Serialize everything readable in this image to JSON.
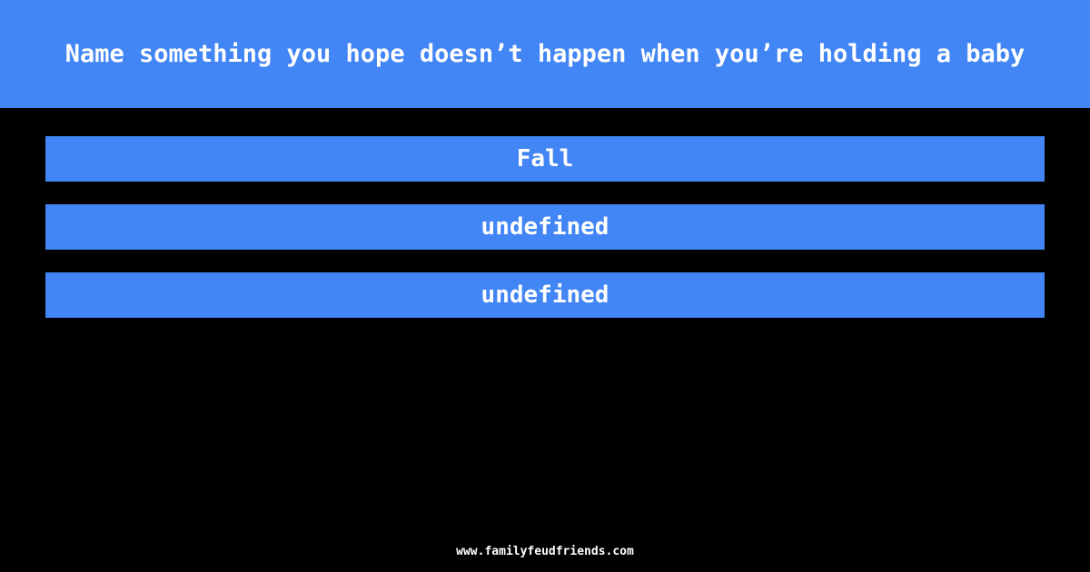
{
  "theme": {
    "background_color": "#000000",
    "accent_color": "#4285f4",
    "text_color": "#ffffff"
  },
  "header": {
    "question": "Name something you hope doesn’t happen when you’re holding a baby"
  },
  "answers": {
    "items": [
      {
        "label": "Fall"
      },
      {
        "label": "undefined"
      },
      {
        "label": "undefined"
      }
    ]
  },
  "footer": {
    "site": "www.familyfeudfriends.com"
  }
}
